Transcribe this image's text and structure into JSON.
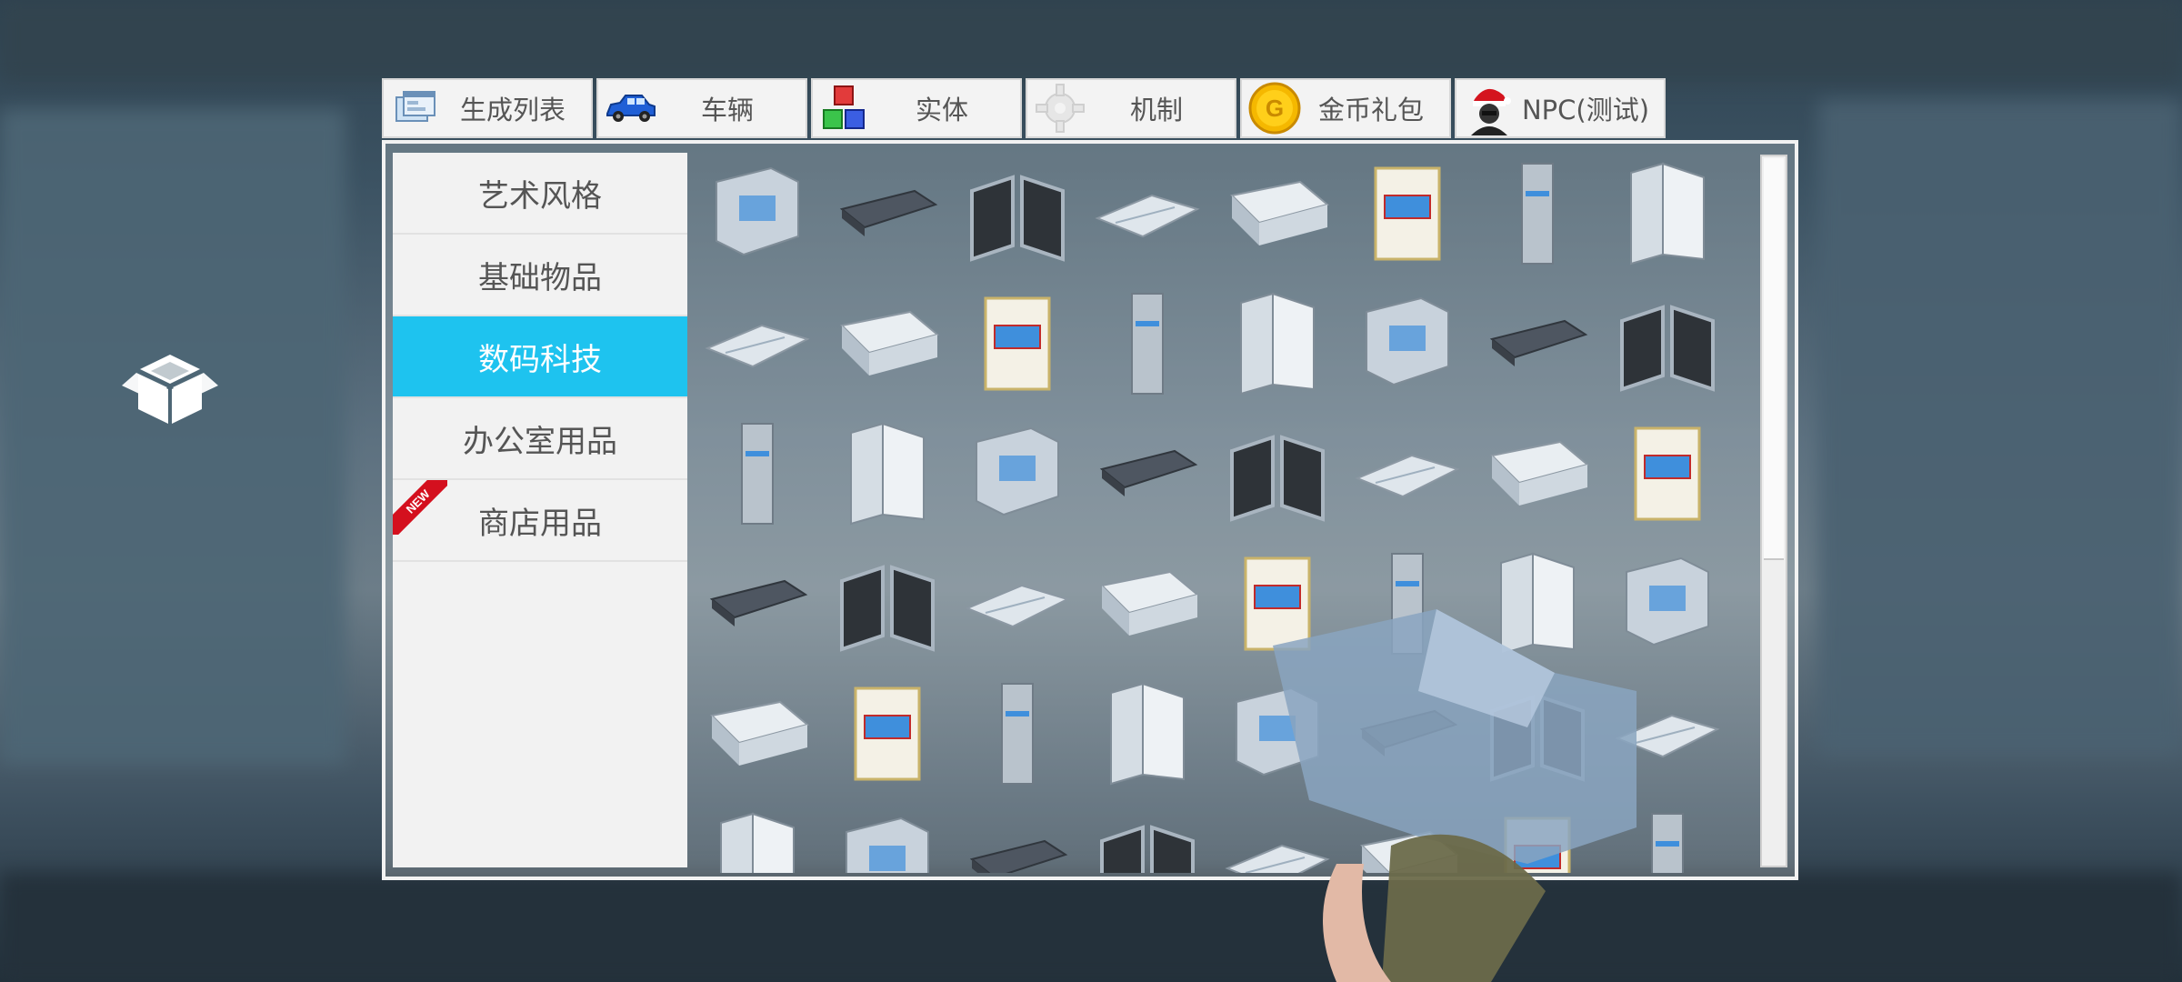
{
  "tabs": [
    {
      "label": "生成列表",
      "icon": "spawn-list-icon"
    },
    {
      "label": "车辆",
      "icon": "car-icon"
    },
    {
      "label": "实体",
      "icon": "cubes-icon"
    },
    {
      "label": "机制",
      "icon": "gear-icon"
    },
    {
      "label": "金币礼包",
      "icon": "gold-coin-icon"
    },
    {
      "label": "NPC(测试)",
      "icon": "npc-santa-icon"
    }
  ],
  "categories": [
    {
      "label": "艺术风格",
      "active": false
    },
    {
      "label": "基础物品",
      "active": false
    },
    {
      "label": "数码科技",
      "active": true
    },
    {
      "label": "办公室用品",
      "active": false
    },
    {
      "label": "商店用品",
      "active": false,
      "badge": "NEW"
    }
  ],
  "colors": {
    "accent": "#1ec3ef",
    "tab_bg": "#f3f3f3",
    "badge": "#d4101e"
  },
  "grid_item_count": 48
}
